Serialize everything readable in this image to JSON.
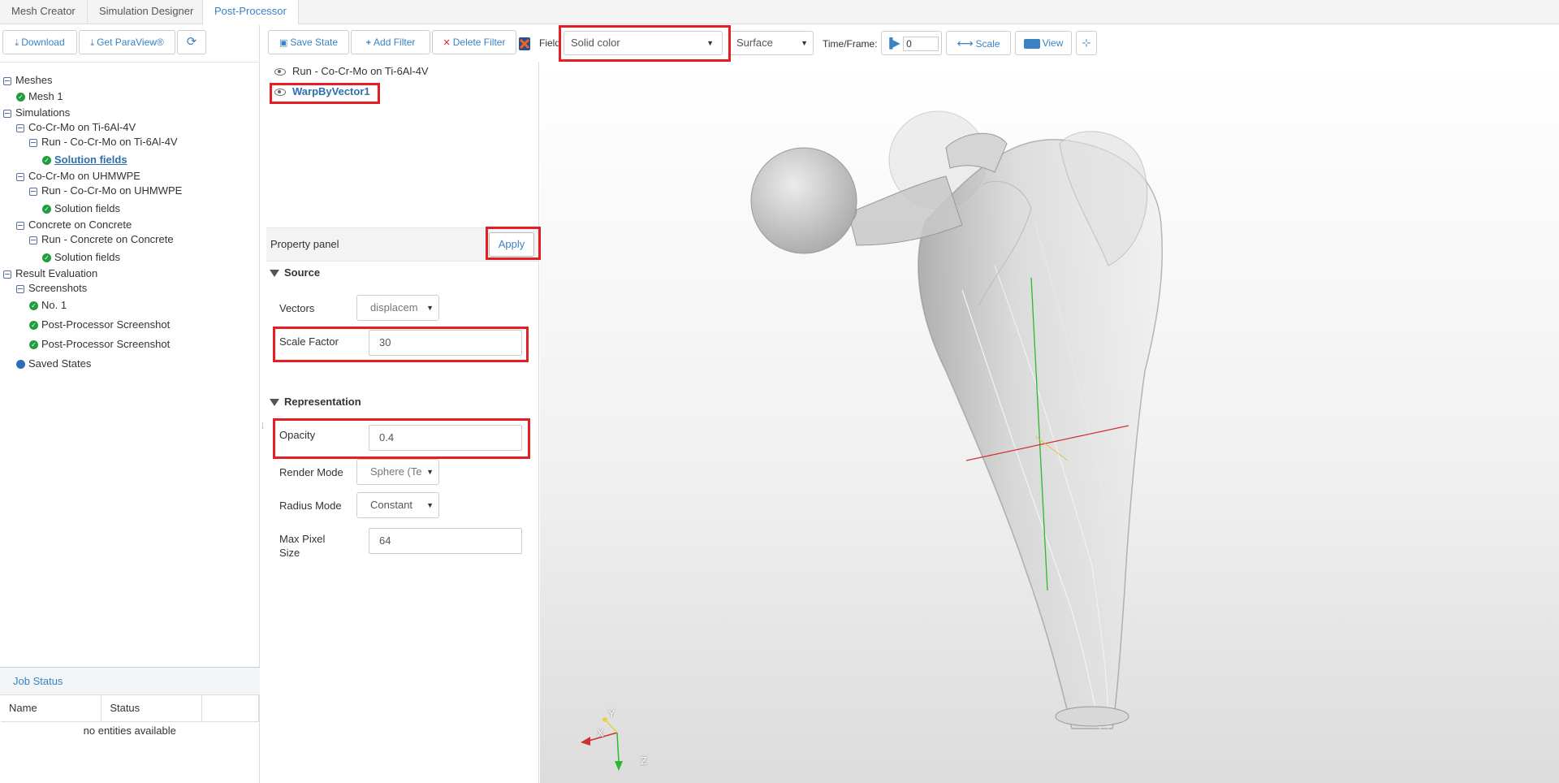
{
  "tabs": [
    {
      "label": "Mesh Creator"
    },
    {
      "label": "Simulation Designer"
    },
    {
      "label": "Post-Processor"
    }
  ],
  "left_toolbar": {
    "download": "Download",
    "get_paraview": "Get ParaView®"
  },
  "tree": {
    "meshes": "Meshes",
    "mesh1": "Mesh 1",
    "simulations": "Simulations",
    "sim1": "Co-Cr-Mo on Ti-6Al-4V",
    "run1": "Run - Co-Cr-Mo on Ti-6Al-4V",
    "sol1": "Solution fields",
    "sim2": "Co-Cr-Mo on UHMWPE",
    "run2": "Run - Co-Cr-Mo on UHMWPE",
    "sol2": "Solution fields",
    "sim3": "Concrete on Concrete",
    "run3": "Run - Concrete on Concrete",
    "sol3": "Solution fields",
    "result_eval": "Result Evaluation",
    "screenshots": "Screenshots",
    "shot1": "No. 1",
    "shot2": "Post-Processor Screenshot",
    "shot3": "Post-Processor Screenshot",
    "saved_states": "Saved States"
  },
  "job_status": {
    "title": "Job Status",
    "col_name": "Name",
    "col_status": "Status",
    "empty": "no entities available"
  },
  "mid_toolbar": {
    "save_state": "Save State",
    "add_filter": "Add Filter",
    "delete_filter": "Delete Filter"
  },
  "pipeline": {
    "item1": "Run - Co-Cr-Mo on Ti-6Al-4V",
    "item2": "WarpByVector1"
  },
  "property_panel": {
    "title": "Property panel",
    "apply": "Apply",
    "source_section": "Source",
    "vectors_label": "Vectors",
    "vectors_value": "displacem",
    "scale_factor_label": "Scale Factor",
    "scale_factor_value": "30",
    "representation_section": "Representation",
    "opacity_label": "Opacity",
    "opacity_value": "0.4",
    "render_mode_label": "Render Mode",
    "render_mode_value": "Sphere (Te",
    "radius_mode_label": "Radius Mode",
    "radius_mode_value": "Constant",
    "max_pixel_label_1": "Max Pixel",
    "max_pixel_label_2": "Size",
    "max_pixel_value": "64"
  },
  "viewer_toolbar": {
    "field_label": "Field",
    "field_value": "Solid color",
    "representation_value": "Surface",
    "time_label": "Time/Frame:",
    "time_value": "0",
    "scale": "Scale",
    "view": "View"
  },
  "axes": {
    "x": "X",
    "y": "Y",
    "z": "Z"
  },
  "colors": {
    "accent": "#3a82c4",
    "highlight": "#e31e24",
    "ok": "#1f9e3c"
  }
}
